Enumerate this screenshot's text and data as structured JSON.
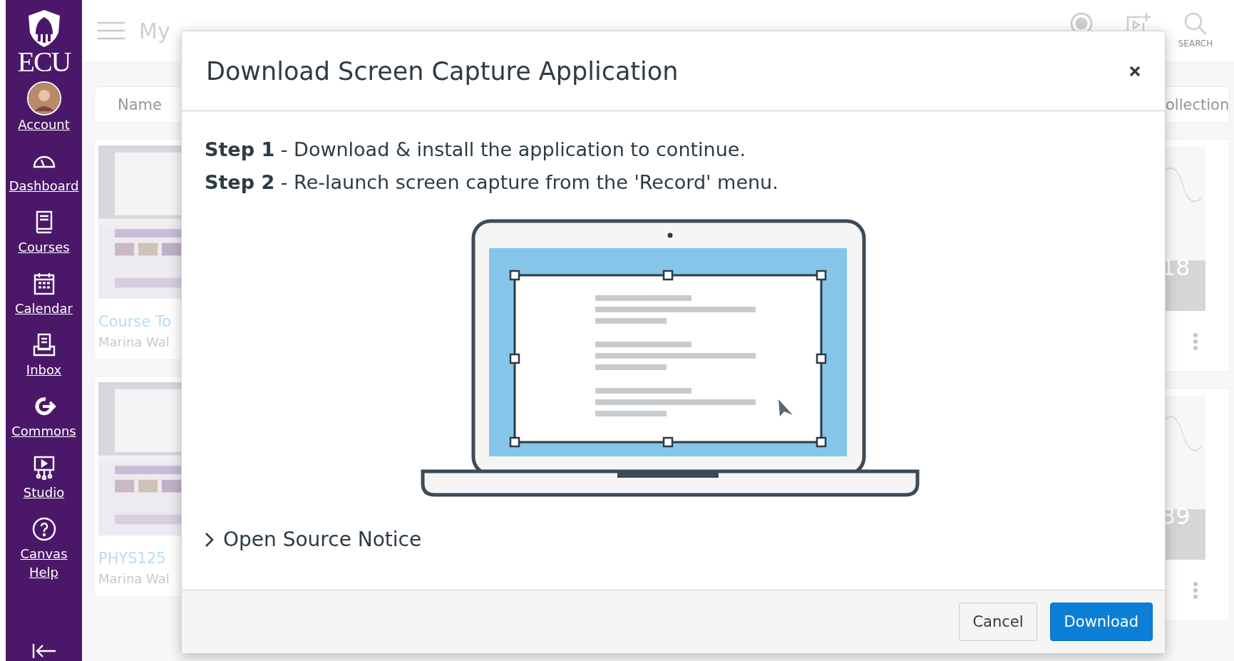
{
  "sidebar": {
    "logo": "ECU",
    "items": [
      {
        "label": "Account",
        "kind": "avatar"
      },
      {
        "label": "Dashboard",
        "kind": "dashboard"
      },
      {
        "label": "Courses",
        "kind": "courses"
      },
      {
        "label": "Calendar",
        "kind": "calendar"
      },
      {
        "label": "Inbox",
        "kind": "inbox"
      },
      {
        "label": "Commons",
        "kind": "commons"
      },
      {
        "label": "Studio",
        "kind": "studio"
      },
      {
        "label": "Canvas Help",
        "kind": "help"
      }
    ]
  },
  "header": {
    "title": "My",
    "actions": [
      {
        "kind": "record"
      },
      {
        "kind": "add"
      },
      {
        "label": "SEARCH",
        "kind": "search"
      }
    ]
  },
  "toolbar": {
    "search_placeholder": "Name",
    "collection": "ollection"
  },
  "left_cards": [
    {
      "title": "Course To",
      "author": "Marina Wal"
    },
    {
      "title": "PHYS125",
      "author": "Marina Wal"
    }
  ],
  "right_cards": [
    {
      "count": "18"
    },
    {
      "count": "39"
    }
  ],
  "dialog": {
    "title": "Download Screen Capture Application",
    "steps": [
      "**Step 1** - Download & install the application to continue.",
      "**Step 2** - Re-launch screen capture from the 'Record' menu."
    ],
    "disclosure": {
      "label": "Open Source Notice",
      "expanded": false
    },
    "buttons": [
      {
        "label": "Cancel",
        "kind": "secondary"
      },
      {
        "label": "Download",
        "kind": "primary"
      }
    ]
  }
}
